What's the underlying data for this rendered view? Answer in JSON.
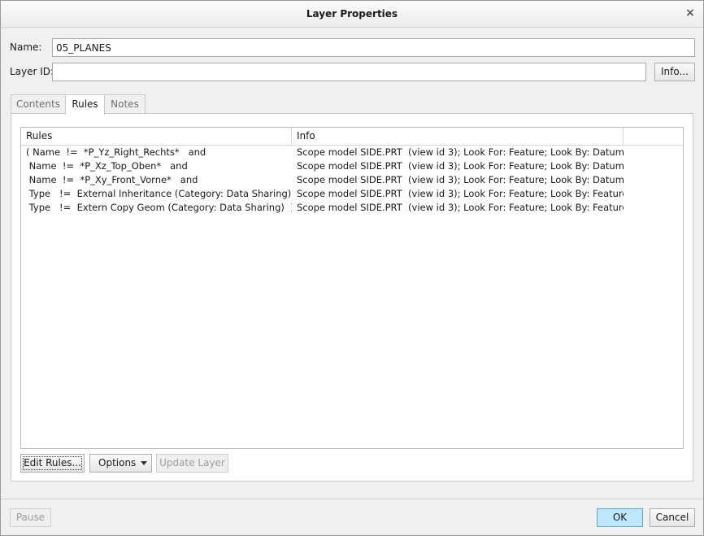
{
  "window": {
    "title": "Layer Properties",
    "close_symbol": "×"
  },
  "form": {
    "name_label": "Name:",
    "name_value": "05_PLANES",
    "layer_id_label": "Layer ID:",
    "layer_id_value": "",
    "info_button": "Info..."
  },
  "tabs": [
    {
      "label": "Contents",
      "active": false
    },
    {
      "label": "Rules",
      "active": true
    },
    {
      "label": "Notes",
      "active": false
    }
  ],
  "rules_table": {
    "columns": [
      "Rules",
      "Info",
      ""
    ],
    "rows": [
      {
        "rule": "( Name  !=  *P_Yz_Right_Rechts*   and",
        "info": "Scope model SIDE.PRT  (view id 3); Look For: Feature; Look By: Datum Plane"
      },
      {
        "rule": " Name  !=  *P_Xz_Top_Oben*   and",
        "info": "Scope model SIDE.PRT  (view id 3); Look For: Feature; Look By: Datum Plane"
      },
      {
        "rule": " Name  !=  *P_Xy_Front_Vorne*   and",
        "info": "Scope model SIDE.PRT  (view id 3); Look For: Feature; Look By: Datum Plane"
      },
      {
        "rule": " Type   !=  External Inheritance (Category: Data Sharing)   and",
        "info": "Scope model SIDE.PRT  (view id 3); Look For: Feature; Look By: Feature"
      },
      {
        "rule": " Type   !=  Extern Copy Geom (Category: Data Sharing)  )",
        "info": "Scope model SIDE.PRT  (view id 3); Look For: Feature; Look By: Feature"
      }
    ]
  },
  "panel_buttons": {
    "edit_rules": "Edit Rules...",
    "options": "Options",
    "update_layer": "Update Layer"
  },
  "footer": {
    "pause": "Pause",
    "ok": "OK",
    "cancel": "Cancel"
  },
  "colors": {
    "ok_button_bg": "#bfe7fb",
    "dialog_bg": "#f0f0f0"
  }
}
